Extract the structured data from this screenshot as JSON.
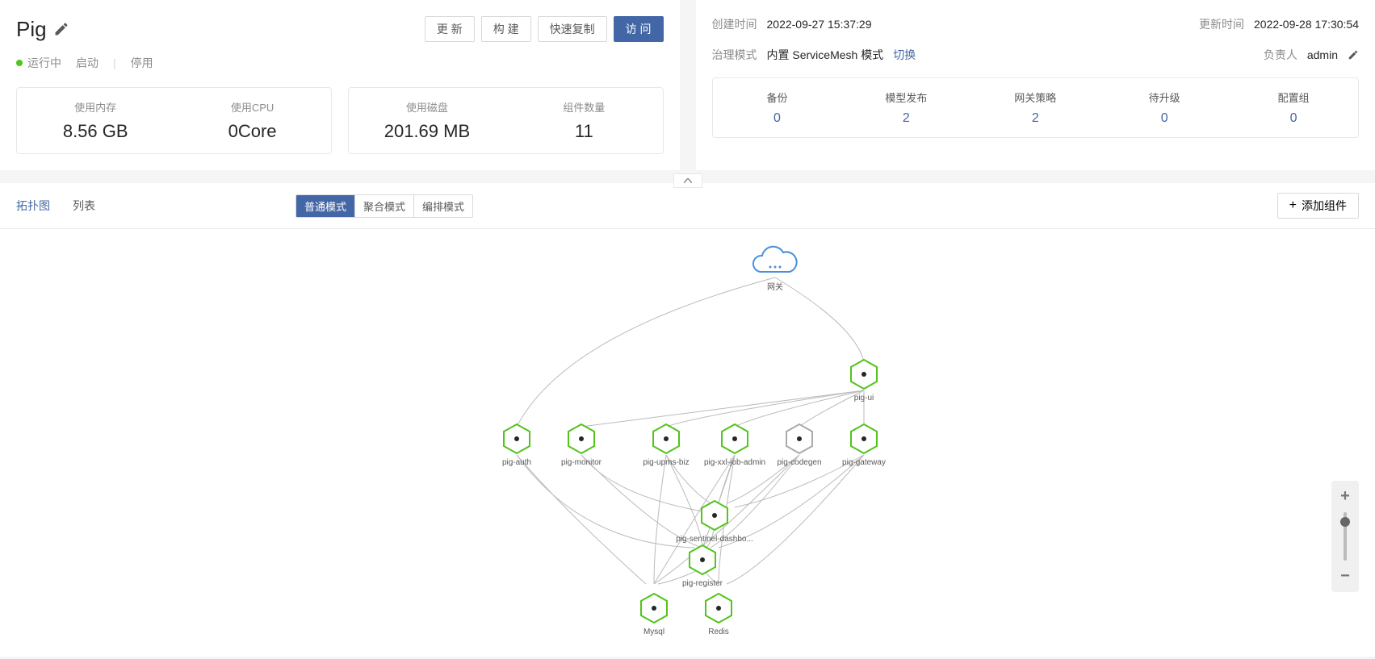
{
  "title": "Pig",
  "status": {
    "label": "运行中",
    "start": "启动",
    "stop": "停用"
  },
  "buttons": {
    "refresh": "更 新",
    "build": "构 建",
    "clone": "快速复制",
    "visit": "访 问"
  },
  "stats": [
    {
      "label": "使用内存",
      "value": "8.56 GB"
    },
    {
      "label": "使用CPU",
      "value": "0Core"
    },
    {
      "label": "使用磁盘",
      "value": "201.69 MB"
    },
    {
      "label": "组件数量",
      "value": "11"
    }
  ],
  "meta": {
    "createLabel": "创建时间",
    "createValue": "2022-09-27 15:37:29",
    "updateLabel": "更新时间",
    "updateValue": "2022-09-28 17:30:54",
    "modeLabel": "治理模式",
    "modeValue": "内置 ServiceMesh 模式",
    "modeSwitch": "切换",
    "ownerLabel": "负责人",
    "ownerValue": "admin"
  },
  "counts": [
    {
      "label": "备份",
      "value": "0"
    },
    {
      "label": "模型发布",
      "value": "2"
    },
    {
      "label": "网关策略",
      "value": "2"
    },
    {
      "label": "待升级",
      "value": "0"
    },
    {
      "label": "配置组",
      "value": "0"
    }
  ],
  "tabs": {
    "topo": "拓扑图",
    "list": "列表"
  },
  "modes": {
    "normal": "普通模式",
    "aggregate": "聚合模式",
    "arrange": "编排模式"
  },
  "addBtn": "添加组件",
  "graph": {
    "gateway": "网关",
    "nodes": [
      {
        "id": "pig-ui",
        "label": "pig-ui"
      },
      {
        "id": "pig-auth",
        "label": "pig-auth"
      },
      {
        "id": "pig-monitor",
        "label": "pig-monitor"
      },
      {
        "id": "pig-upms-biz",
        "label": "pig-upms-biz"
      },
      {
        "id": "pig-xxl-job-admin",
        "label": "pig-xxl-job-admin"
      },
      {
        "id": "pig-codegen",
        "label": "pig-codegen",
        "gray": true
      },
      {
        "id": "pig-gateway",
        "label": "pig-gateway"
      },
      {
        "id": "pig-sentinel",
        "label": "pig-sentinel-dashbo..."
      },
      {
        "id": "pig-register",
        "label": "pig-register"
      },
      {
        "id": "mysql",
        "label": "Mysql"
      },
      {
        "id": "redis",
        "label": "Redis"
      }
    ]
  }
}
